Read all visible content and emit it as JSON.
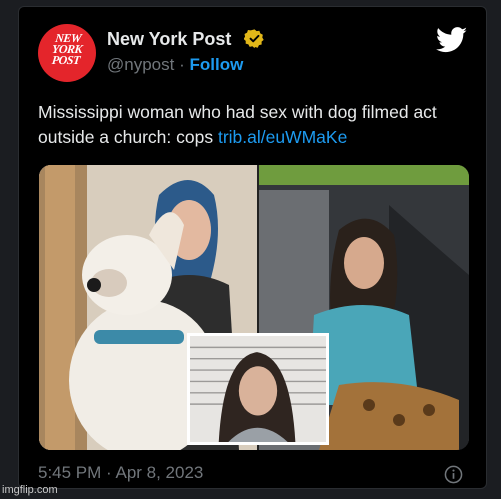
{
  "tweet": {
    "display_name": "New York Post",
    "handle": "@nypost",
    "separator": "·",
    "follow_label": "Follow",
    "avatar_text_line1": "NEW",
    "avatar_text_line2": "YORK",
    "avatar_text_line3": "POST",
    "body_text": "Mississippi woman who had sex with dog filmed act outside a church: cops ",
    "link_text": "trib.al/euWMaKe",
    "timestamp": "5:45 PM · Apr 8, 2023"
  },
  "icons": {
    "verified": "verified-badge-icon",
    "platform": "twitter-bird-icon",
    "info": "info-icon"
  },
  "colors": {
    "background": "#000000",
    "text_primary": "#e7e9ea",
    "text_secondary": "#71767b",
    "accent": "#1d9bf0",
    "verified_gold": "#e2b719",
    "avatar_red": "#e4252b"
  },
  "watermark": "imgflip.com"
}
